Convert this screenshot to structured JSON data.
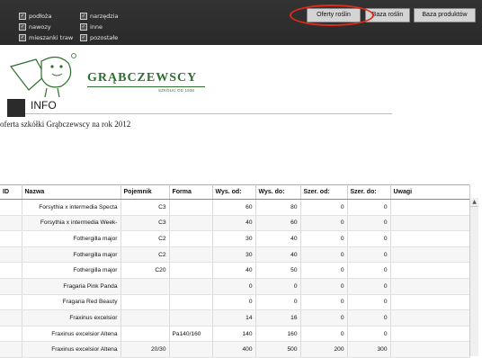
{
  "filters": [
    {
      "label": "podłoża"
    },
    {
      "label": "nawozy"
    },
    {
      "label": "mieszanki traw"
    },
    {
      "label": "narzędzia"
    },
    {
      "label": "inne"
    },
    {
      "label": "pozostałe"
    }
  ],
  "nav": {
    "oferty": "Oferty roślin",
    "baza_roslin": "Baza roślin",
    "baza_produktow": "Baza produktów"
  },
  "brand": {
    "name": "GRĄBCZEWSCY",
    "tagline": "SZKÓŁKI OD 1936"
  },
  "info": {
    "title": "INFO",
    "description": "oferta szkółki Grąbczewscy na rok 2012"
  },
  "table": {
    "headers": [
      "ID",
      "Nazwa",
      "Pojemnik",
      "Forma",
      "Wys. od:",
      "Wys. do:",
      "Szer. od:",
      "Szer. do:",
      "Uwagi"
    ],
    "rows": [
      [
        "",
        "Forsythia x intermedia Specta",
        "C3",
        "",
        "60",
        "80",
        "0",
        "0",
        ""
      ],
      [
        "",
        "Forsythia x intermedia Week-",
        "C3",
        "",
        "40",
        "60",
        "0",
        "0",
        ""
      ],
      [
        "",
        "Fothergilla major",
        "C2",
        "",
        "30",
        "40",
        "0",
        "0",
        ""
      ],
      [
        "",
        "Fothergilla major",
        "C2",
        "",
        "30",
        "40",
        "0",
        "0",
        ""
      ],
      [
        "",
        "Fothergilla major",
        "C20",
        "",
        "40",
        "50",
        "0",
        "0",
        ""
      ],
      [
        "",
        "Fragaria Pink Panda",
        "",
        "",
        "0",
        "0",
        "0",
        "0",
        ""
      ],
      [
        "",
        "Fragaria Red Beauty",
        "",
        "",
        "0",
        "0",
        "0",
        "0",
        ""
      ],
      [
        "",
        "Fraxinus excelsior",
        "",
        "",
        "14",
        "16",
        "0",
        "0",
        ""
      ],
      [
        "",
        "Fraxinus excelsior Altena",
        "",
        "Pa140/160",
        "140",
        "160",
        "0",
        "0",
        ""
      ],
      [
        "",
        "Fraxinus excelsior Altena",
        "20/30",
        "",
        "400",
        "500",
        "200",
        "300",
        ""
      ]
    ]
  }
}
